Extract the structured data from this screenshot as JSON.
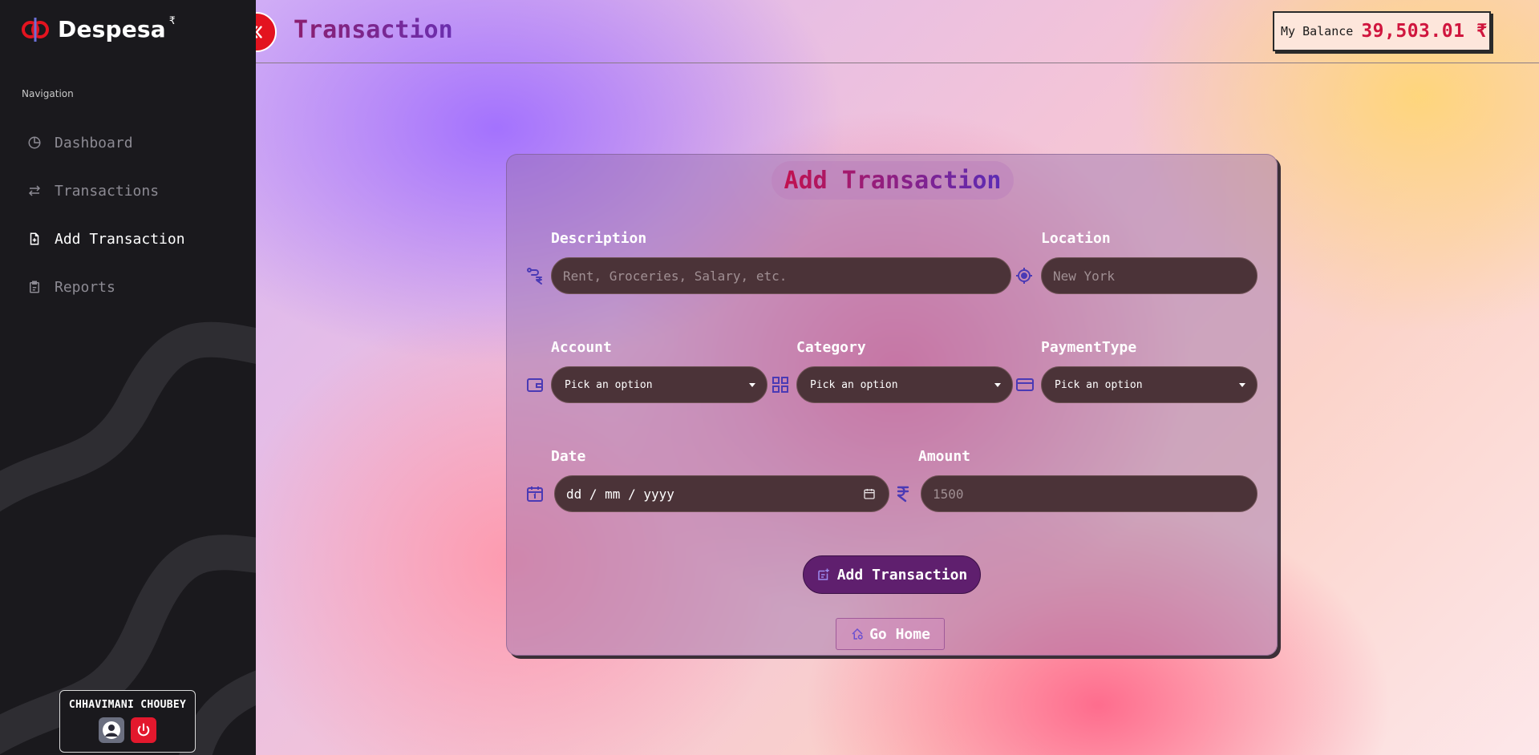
{
  "app": {
    "name": "Despesa",
    "name_sup": "₹"
  },
  "sidebar": {
    "heading": "Navigation",
    "items": [
      {
        "label": "Dashboard",
        "icon": "pie-chart-icon",
        "active": false
      },
      {
        "label": "Transactions",
        "icon": "arrows-exchange-icon",
        "active": false
      },
      {
        "label": "Add Transaction",
        "icon": "file-plus-icon",
        "active": true
      },
      {
        "label": "Reports",
        "icon": "clipboard-icon",
        "active": false
      }
    ],
    "user": {
      "name": "CHHAVIMANI CHOUBEY"
    }
  },
  "header": {
    "title": "Transaction",
    "balance_label": "My Balance",
    "balance_value": "39,503.01 ₹"
  },
  "form": {
    "title": "Add Transaction",
    "description": {
      "label": "Description",
      "placeholder": "Rent, Groceries, Salary, etc."
    },
    "location": {
      "label": "Location",
      "placeholder": "New York"
    },
    "account": {
      "label": "Account",
      "value": "Pick an option"
    },
    "category": {
      "label": "Category",
      "value": "Pick an option"
    },
    "payment_type": {
      "label": "PaymentType",
      "value": "Pick an option"
    },
    "date": {
      "label": "Date",
      "value": "dd / mm / yyyy"
    },
    "amount": {
      "label": "Amount",
      "placeholder": "1500"
    },
    "submit_label": "Add Transaction",
    "home_label": "Go Home"
  },
  "colors": {
    "accent_red": "#e3131f",
    "balance_value": "#d0163e",
    "sidebar_bg": "#1a191d",
    "input_bg": "#4b3338",
    "submit_bg": "#5f1f6e"
  }
}
